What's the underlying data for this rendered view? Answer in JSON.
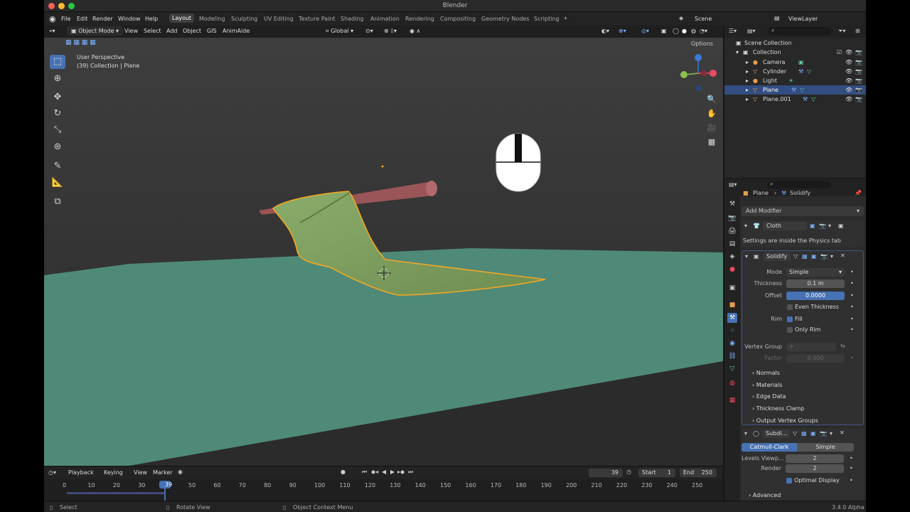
{
  "app": {
    "title": "Blender",
    "version": "3.4.0 Alpha"
  },
  "menu": [
    "File",
    "Edit",
    "Render",
    "Window",
    "Help"
  ],
  "workspaces": [
    "Layout",
    "Modeling",
    "Sculpting",
    "UV Editing",
    "Texture Paint",
    "Shading",
    "Animation",
    "Rendering",
    "Compositing",
    "Geometry Nodes",
    "Scripting"
  ],
  "active_workspace": "Layout",
  "scene": {
    "label": "Scene",
    "view_layer": "ViewLayer"
  },
  "viewport": {
    "mode": "Object Mode",
    "menus": [
      "View",
      "Select",
      "Add",
      "Object",
      "GIS",
      "AnimAide"
    ],
    "orientation": "Global",
    "options": "Options",
    "perspective": "User Perspective",
    "context": "(39) Collection | Plane"
  },
  "outliner": {
    "root": "Scene Collection",
    "collection": "Collection",
    "items": [
      "Camera",
      "Cylinder",
      "Light",
      "Plane",
      "Plane.001"
    ],
    "selected": "Plane"
  },
  "properties": {
    "breadcrumb_object": "Plane",
    "breadcrumb_modifier": "Solidify",
    "add_modifier": "Add Modifier",
    "cloth": {
      "name": "Cloth",
      "note": "Settings are inside the Physics tab"
    },
    "solidify": {
      "name": "Solidify",
      "mode_label": "Mode",
      "mode": "Simple",
      "thickness_label": "Thickness",
      "thickness": "0.1 m",
      "offset_label": "Offset",
      "offset": "0.0000",
      "even_thickness": "Even Thickness",
      "rim_label": "Rim",
      "fill": "Fill",
      "only_rim": "Only Rim",
      "vertex_group_label": "Vertex Group",
      "factor_label": "Factor",
      "factor": "0.000",
      "subpanels": [
        "Normals",
        "Materials",
        "Edge Data",
        "Thickness Clamp",
        "Output Vertex Groups"
      ]
    },
    "subdivision": {
      "name": "Subdi...",
      "catmull": "Catmull-Clark",
      "simple": "Simple",
      "levels_label": "Levels Viewp...",
      "levels": "2",
      "render_label": "Render",
      "render": "2",
      "optimal": "Optimal Display",
      "advanced": "Advanced"
    }
  },
  "timeline": {
    "menus": [
      "Playback",
      "Keying",
      "View",
      "Marker"
    ],
    "current_frame": "39",
    "start_label": "Start",
    "start": "1",
    "end_label": "End",
    "end": "250",
    "ticks": [
      "0",
      "10",
      "20",
      "30",
      "50",
      "60",
      "70",
      "80",
      "90",
      "100",
      "110",
      "120",
      "130",
      "140",
      "150",
      "160",
      "170",
      "180",
      "190",
      "200",
      "210",
      "220",
      "230",
      "240",
      "250"
    ]
  },
  "status": {
    "select": "Select",
    "rotate": "Rotate View",
    "context_menu": "Object Context Menu"
  },
  "colors": {
    "accent": "#4772b3",
    "selection_outline": "#f5a623",
    "ground": "#4f8a78",
    "cloth": "#7a9b5c",
    "cylinder": "#a0585a"
  }
}
